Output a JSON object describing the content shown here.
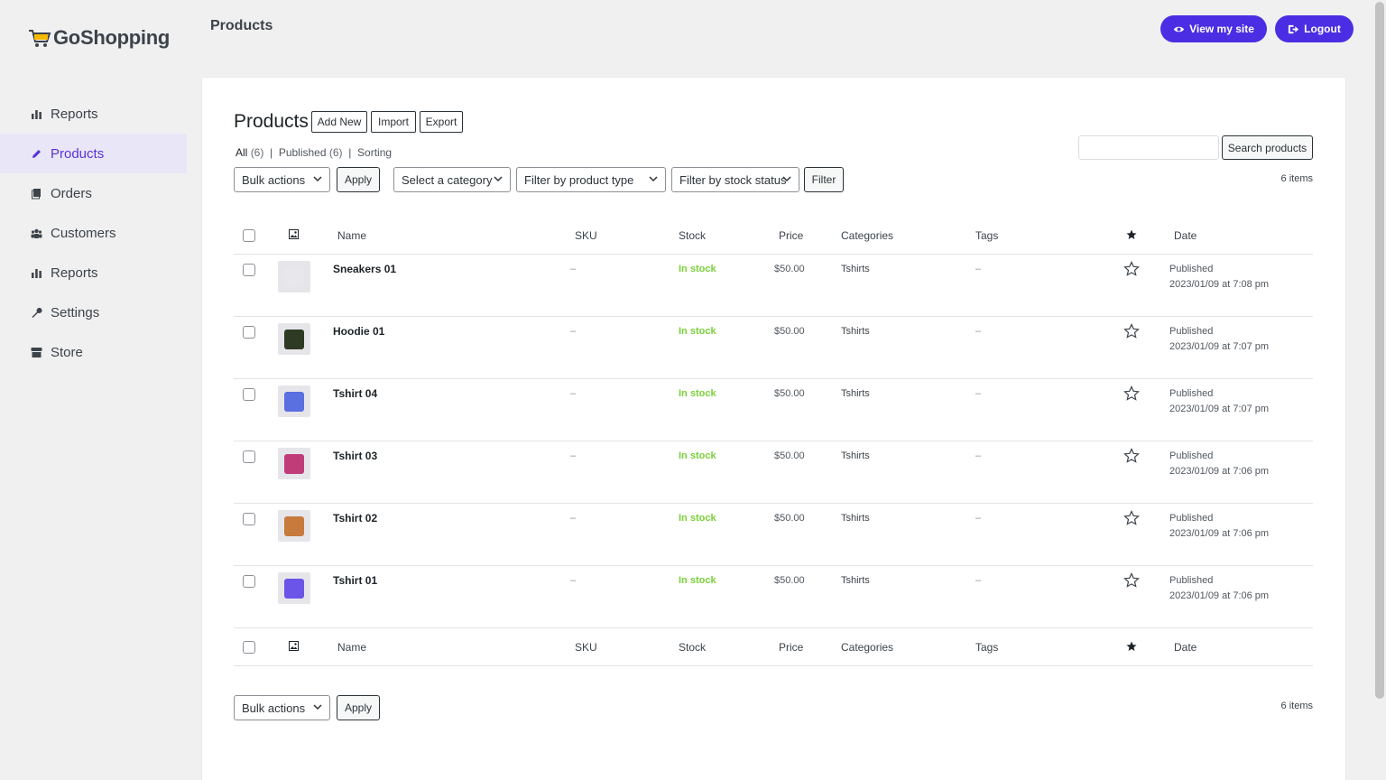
{
  "app": {
    "logo_text": "GoShopping",
    "page_heading": "Products",
    "view_site_label": "View my site",
    "logout_label": "Logout",
    "accent_color": "#4b2ee3"
  },
  "sidebar": {
    "items": [
      {
        "label": "Reports",
        "icon": "bar-chart-icon"
      },
      {
        "label": "Products",
        "icon": "pencil-icon",
        "active": true
      },
      {
        "label": "Orders",
        "icon": "copy-icon"
      },
      {
        "label": "Customers",
        "icon": "users-icon"
      },
      {
        "label": "Reports",
        "icon": "bar-chart-icon"
      },
      {
        "label": "Settings",
        "icon": "wrench-icon"
      },
      {
        "label": "Store",
        "icon": "store-icon"
      }
    ]
  },
  "content": {
    "title": "Products",
    "add_new": "Add New",
    "import": "Import",
    "export": "Export",
    "views": {
      "all": "All",
      "all_count": "(6)",
      "published": "Published",
      "published_count": "(6)",
      "sorting": "Sorting",
      "sep": "|"
    },
    "bulk_actions": "Bulk actions",
    "apply": "Apply",
    "select_category": "Select a category",
    "filter_product_type": "Filter by product type",
    "filter_stock_status": "Filter by stock status",
    "filter": "Filter",
    "search_button": "Search products",
    "search_value": "",
    "items_count": "6 items"
  },
  "table": {
    "headers": {
      "name": "Name",
      "sku": "SKU",
      "stock": "Stock",
      "price": "Price",
      "categories": "Categories",
      "tags": "Tags",
      "date": "Date"
    },
    "rows": [
      {
        "name": "Sneakers 01",
        "sku": "–",
        "stock": "In stock",
        "price": "$50.00",
        "categories": "Tshirts",
        "tags": "–",
        "status": "Published",
        "date": "2023/01/09 at 7:08 pm",
        "thumb_color": "#e8e8ec"
      },
      {
        "name": "Hoodie 01",
        "sku": "–",
        "stock": "In stock",
        "price": "$50.00",
        "categories": "Tshirts",
        "tags": "–",
        "status": "Published",
        "date": "2023/01/09 at 7:07 pm",
        "thumb_color": "#2f3a24"
      },
      {
        "name": "Tshirt 04",
        "sku": "–",
        "stock": "In stock",
        "price": "$50.00",
        "categories": "Tshirts",
        "tags": "–",
        "status": "Published",
        "date": "2023/01/09 at 7:07 pm",
        "thumb_color": "#5a6fe0"
      },
      {
        "name": "Tshirt 03",
        "sku": "–",
        "stock": "In stock",
        "price": "$50.00",
        "categories": "Tshirts",
        "tags": "–",
        "status": "Published",
        "date": "2023/01/09 at 7:06 pm",
        "thumb_color": "#c03c78"
      },
      {
        "name": "Tshirt 02",
        "sku": "–",
        "stock": "In stock",
        "price": "$50.00",
        "categories": "Tshirts",
        "tags": "–",
        "status": "Published",
        "date": "2023/01/09 at 7:06 pm",
        "thumb_color": "#c87a3c"
      },
      {
        "name": "Tshirt 01",
        "sku": "–",
        "stock": "In stock",
        "price": "$50.00",
        "categories": "Tshirts",
        "tags": "–",
        "status": "Published",
        "date": "2023/01/09 at 7:06 pm",
        "thumb_color": "#6a55e8"
      }
    ]
  }
}
